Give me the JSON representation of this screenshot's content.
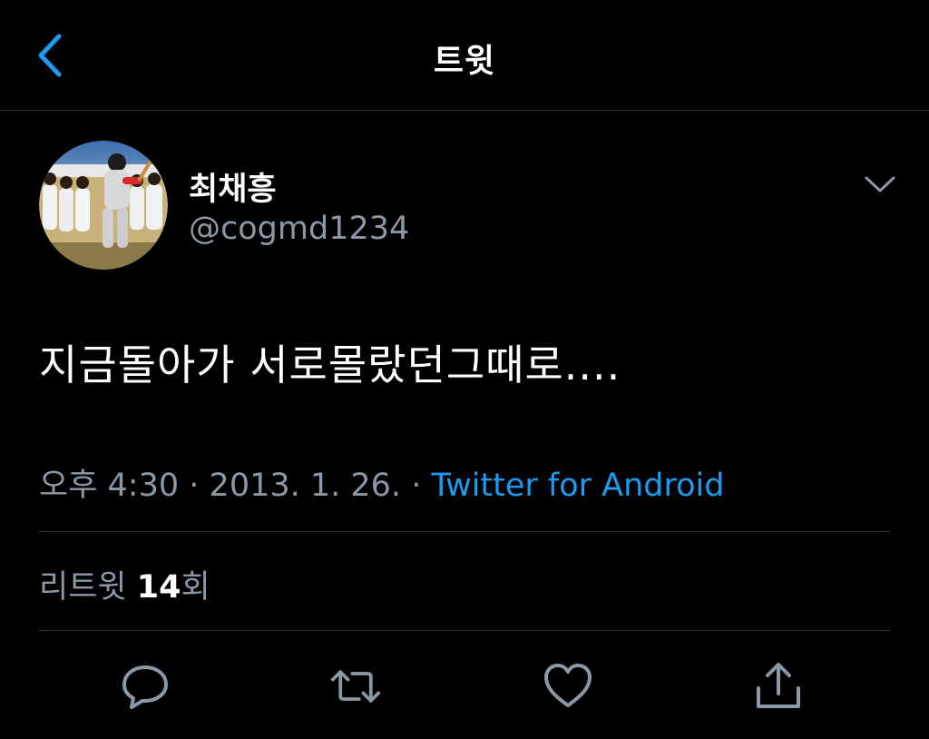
{
  "header": {
    "title": "트윗",
    "back_icon": "chevron-left-icon"
  },
  "tweet": {
    "author": {
      "display_name": "최채흥",
      "handle": "@cogmd1234",
      "avatar": "baseball-player-photo"
    },
    "text": "지금돌아가  서로몰랐던그때로....",
    "time": "오후 4:30",
    "date": "2013. 1. 26.",
    "separator": "·",
    "source": "Twitter for Android",
    "stats": {
      "retweet_label": "리트윗",
      "retweet_count": "14",
      "retweet_unit": "회"
    }
  },
  "actions": [
    {
      "name": "reply",
      "icon": "reply-icon"
    },
    {
      "name": "retweet",
      "icon": "retweet-icon"
    },
    {
      "name": "like",
      "icon": "heart-icon"
    },
    {
      "name": "share",
      "icon": "share-icon"
    }
  ],
  "colors": {
    "background": "#000000",
    "accent": "#1d9bf0",
    "secondary_text": "#8b98a5",
    "divider": "#2f3336",
    "icon": "#8b98a5"
  }
}
